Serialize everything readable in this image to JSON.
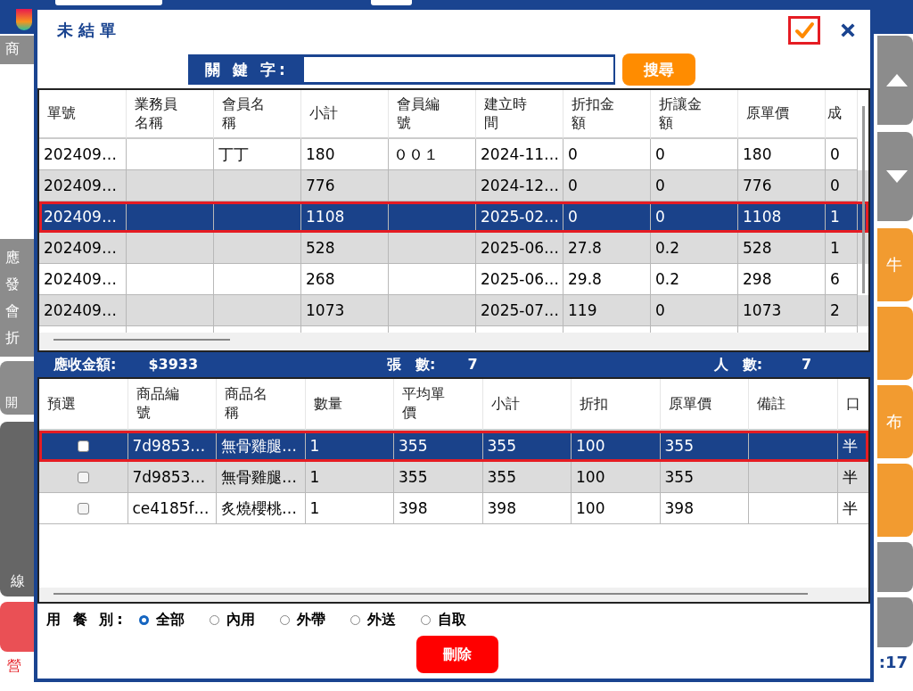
{
  "background": {
    "left_labels": [
      "商",
      "應",
      "發",
      "會",
      "折",
      "開",
      "線"
    ],
    "footer_left": "營",
    "right_labels": [
      "牛",
      "布"
    ],
    "clock": ":17"
  },
  "dialog": {
    "title": "未結單",
    "search": {
      "label": "關 鍵 字:",
      "button": "搜尋"
    },
    "orders": {
      "columns": [
        "單號",
        "業務員名稱",
        "會員名稱",
        "小計",
        "會員編號",
        "建立時間",
        "折扣金額",
        "折讓金額",
        "原單價",
        "成"
      ],
      "rows": [
        {
          "selected": false,
          "cells": [
            "202409…",
            "",
            "丁丁",
            "180",
            "００１",
            "2024-11…",
            "0",
            "0",
            "180",
            "0"
          ]
        },
        {
          "selected": false,
          "cells": [
            "202409…",
            "",
            "",
            "776",
            "",
            "2024-12…",
            "0",
            "0",
            "776",
            "0"
          ]
        },
        {
          "selected": true,
          "cells": [
            "202409…",
            "",
            "",
            "1108",
            "",
            "2025-02…",
            "0",
            "0",
            "1108",
            "1"
          ]
        },
        {
          "selected": false,
          "cells": [
            "202409…",
            "",
            "",
            "528",
            "",
            "2025-06…",
            "27.8",
            "0.2",
            "528",
            "1"
          ]
        },
        {
          "selected": false,
          "cells": [
            "202409…",
            "",
            "",
            "268",
            "",
            "2025-06…",
            "29.8",
            "0.2",
            "298",
            "6"
          ]
        },
        {
          "selected": false,
          "cells": [
            "202409…",
            "",
            "",
            "1073",
            "",
            "2025-07…",
            "119",
            "0",
            "1073",
            "2"
          ]
        }
      ]
    },
    "summary": [
      {
        "label": "應收金額:",
        "value": "$3933"
      },
      {
        "label": "張　數:",
        "value": "7"
      },
      {
        "label": "人　數:",
        "value": "7"
      }
    ],
    "items": {
      "columns": [
        "預選",
        "商品編號",
        "商品名稱",
        "數量",
        "平均單價",
        "小計",
        "折扣",
        "原單價",
        "備註",
        "口"
      ],
      "rows": [
        {
          "selected": true,
          "checked": false,
          "cells": [
            "",
            "7d9853…",
            "無骨雞腿…",
            "1",
            "355",
            "355",
            "100",
            "355",
            "",
            "半"
          ]
        },
        {
          "selected": false,
          "checked": false,
          "cells": [
            "",
            "7d9853…",
            "無骨雞腿…",
            "1",
            "355",
            "355",
            "100",
            "355",
            "",
            "半"
          ]
        },
        {
          "selected": false,
          "checked": false,
          "cells": [
            "",
            "ce4185f…",
            "炙燒櫻桃…",
            "1",
            "398",
            "398",
            "100",
            "398",
            "",
            "半"
          ]
        }
      ]
    },
    "dining": {
      "label": "用 餐 別:",
      "options": [
        {
          "label": "全部",
          "selected": true
        },
        {
          "label": "內用",
          "selected": false
        },
        {
          "label": "外帶",
          "selected": false
        },
        {
          "label": "外送",
          "selected": false
        },
        {
          "label": "自取",
          "selected": false
        }
      ]
    },
    "delete_button": "刪除"
  }
}
